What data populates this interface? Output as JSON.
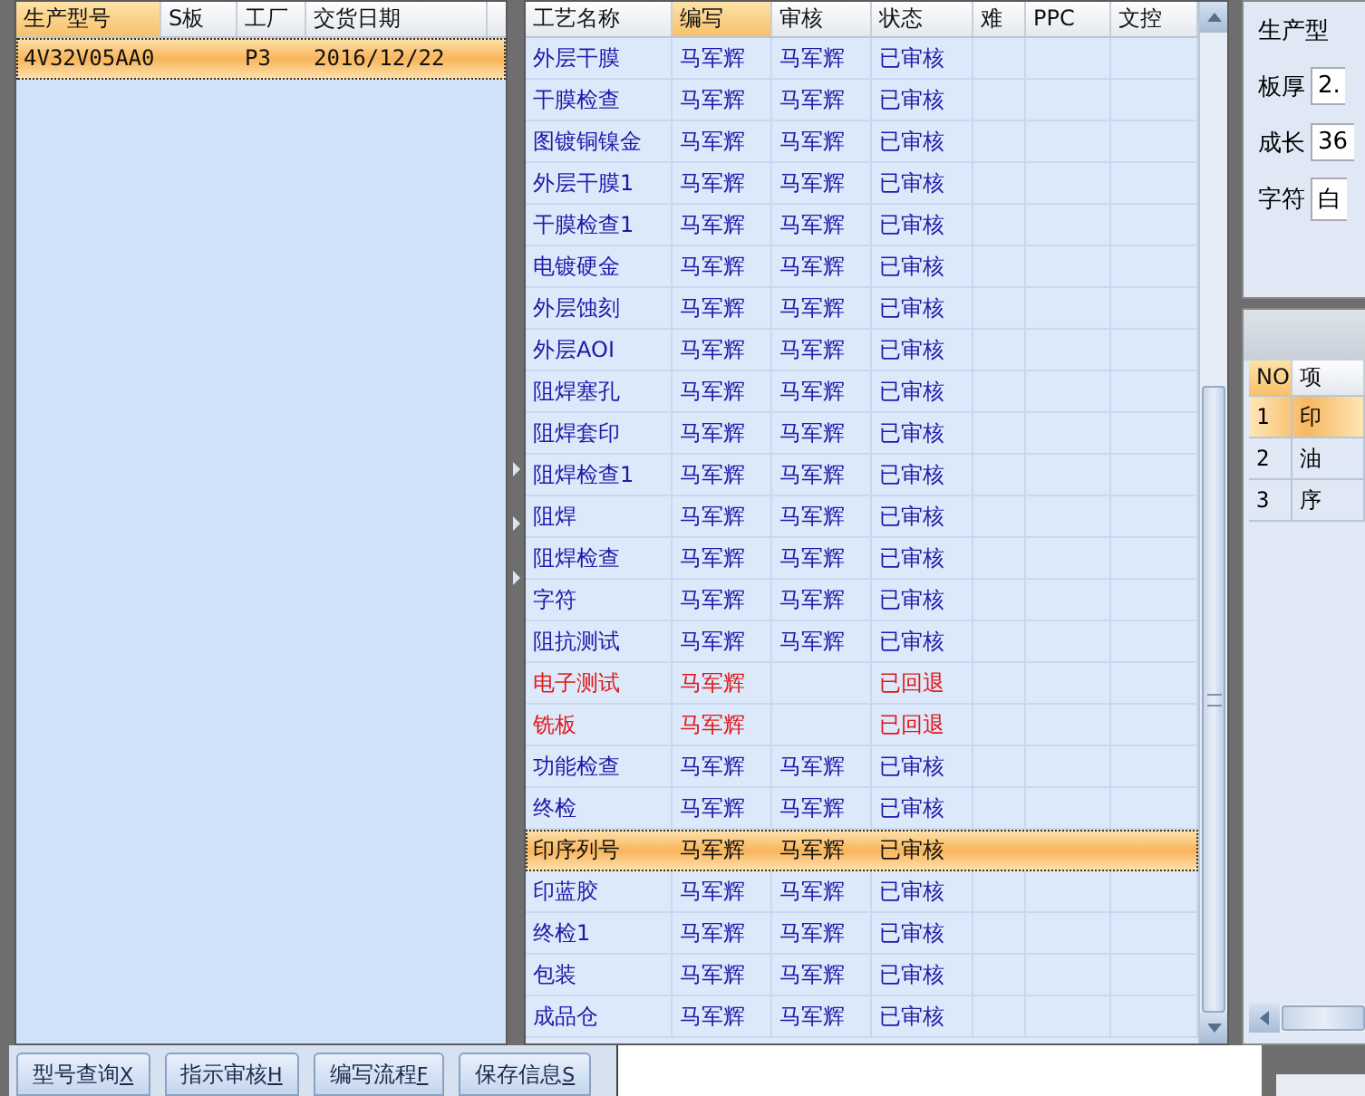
{
  "order_grid": {
    "columns": [
      {
        "label": "生产型号",
        "selected": true
      },
      {
        "label": "S板",
        "selected": false
      },
      {
        "label": "工厂",
        "selected": false
      },
      {
        "label": "交货日期",
        "selected": false
      }
    ],
    "rows": [
      {
        "cells": [
          "4V32V05AA0",
          "",
          "P3",
          "2016/12/22"
        ],
        "selected": true
      }
    ]
  },
  "process_grid": {
    "columns": [
      {
        "label": "工艺名称",
        "selected": false
      },
      {
        "label": "编写",
        "selected": true
      },
      {
        "label": "审核",
        "selected": false
      },
      {
        "label": "状态",
        "selected": false
      },
      {
        "label": "难",
        "selected": false
      },
      {
        "label": "PPC",
        "selected": false
      },
      {
        "label": "文控",
        "selected": false
      }
    ],
    "rows": [
      {
        "name": "外层干膜",
        "writer": "马军辉",
        "reviewer": "马军辉",
        "status": "已审核",
        "kind": "approved",
        "selected": false
      },
      {
        "name": "干膜检查",
        "writer": "马军辉",
        "reviewer": "马军辉",
        "status": "已审核",
        "kind": "approved",
        "selected": false
      },
      {
        "name": "图镀铜镍金",
        "writer": "马军辉",
        "reviewer": "马军辉",
        "status": "已审核",
        "kind": "approved",
        "selected": false
      },
      {
        "name": "外层干膜1",
        "writer": "马军辉",
        "reviewer": "马军辉",
        "status": "已审核",
        "kind": "approved",
        "selected": false
      },
      {
        "name": "干膜检查1",
        "writer": "马军辉",
        "reviewer": "马军辉",
        "status": "已审核",
        "kind": "approved",
        "selected": false
      },
      {
        "name": "电镀硬金",
        "writer": "马军辉",
        "reviewer": "马军辉",
        "status": "已审核",
        "kind": "approved",
        "selected": false
      },
      {
        "name": "外层蚀刻",
        "writer": "马军辉",
        "reviewer": "马军辉",
        "status": "已审核",
        "kind": "approved",
        "selected": false
      },
      {
        "name": "外层AOI",
        "writer": "马军辉",
        "reviewer": "马军辉",
        "status": "已审核",
        "kind": "approved",
        "selected": false
      },
      {
        "name": "阻焊塞孔",
        "writer": "马军辉",
        "reviewer": "马军辉",
        "status": "已审核",
        "kind": "approved",
        "selected": false
      },
      {
        "name": "阻焊套印",
        "writer": "马军辉",
        "reviewer": "马军辉",
        "status": "已审核",
        "kind": "approved",
        "selected": false
      },
      {
        "name": "阻焊检查1",
        "writer": "马军辉",
        "reviewer": "马军辉",
        "status": "已审核",
        "kind": "approved",
        "selected": false
      },
      {
        "name": "阻焊",
        "writer": "马军辉",
        "reviewer": "马军辉",
        "status": "已审核",
        "kind": "approved",
        "selected": false
      },
      {
        "name": "阻焊检查",
        "writer": "马军辉",
        "reviewer": "马军辉",
        "status": "已审核",
        "kind": "approved",
        "selected": false
      },
      {
        "name": "字符",
        "writer": "马军辉",
        "reviewer": "马军辉",
        "status": "已审核",
        "kind": "approved",
        "selected": false
      },
      {
        "name": "阻抗测试",
        "writer": "马军辉",
        "reviewer": "马军辉",
        "status": "已审核",
        "kind": "approved",
        "selected": false
      },
      {
        "name": "电子测试",
        "writer": "马军辉",
        "status": "已回退",
        "kind": "returned",
        "selected": false
      },
      {
        "name": "铣板",
        "writer": "马军辉",
        "status": "已回退",
        "kind": "returned",
        "selected": false
      },
      {
        "name": "功能检查",
        "writer": "马军辉",
        "reviewer": "马军辉",
        "status": "已审核",
        "kind": "approved",
        "selected": false
      },
      {
        "name": "终检",
        "writer": "马军辉",
        "reviewer": "马军辉",
        "status": "已审核",
        "kind": "approved",
        "selected": false
      },
      {
        "name": "印序列号",
        "writer": "马军辉",
        "reviewer": "马军辉",
        "status": "已审核",
        "kind": "approved",
        "selected": true
      },
      {
        "name": "印蓝胶",
        "writer": "马军辉",
        "reviewer": "马军辉",
        "status": "已审核",
        "kind": "approved",
        "selected": false
      },
      {
        "name": "终检1",
        "writer": "马军辉",
        "reviewer": "马军辉",
        "status": "已审核",
        "kind": "approved",
        "selected": false
      },
      {
        "name": "包装",
        "writer": "马军辉",
        "reviewer": "马军辉",
        "status": "已审核",
        "kind": "approved",
        "selected": false
      },
      {
        "name": "成品仓",
        "writer": "马军辉",
        "reviewer": "马军辉",
        "status": "已审核",
        "kind": "approved",
        "selected": false
      }
    ]
  },
  "detail_panel": {
    "title": "生产型",
    "fields": [
      {
        "label": "板厚",
        "value": "2."
      },
      {
        "label": "成长",
        "value": "36"
      },
      {
        "label": "字符",
        "value": "白"
      }
    ]
  },
  "item_grid": {
    "columns": [
      {
        "label": "NO",
        "selected": true
      },
      {
        "label": "项",
        "selected": false
      }
    ],
    "rows": [
      {
        "cells": [
          "1",
          "印"
        ],
        "selected": true
      },
      {
        "cells": [
          "2",
          "油"
        ],
        "selected": false
      },
      {
        "cells": [
          "3",
          "序"
        ],
        "selected": false
      }
    ]
  },
  "buttons": [
    {
      "label": "型号查询",
      "key": "X"
    },
    {
      "label": "指示审核",
      "key": "H"
    },
    {
      "label": "编写流程",
      "key": "F"
    },
    {
      "label": "保存信息",
      "key": "S"
    }
  ]
}
